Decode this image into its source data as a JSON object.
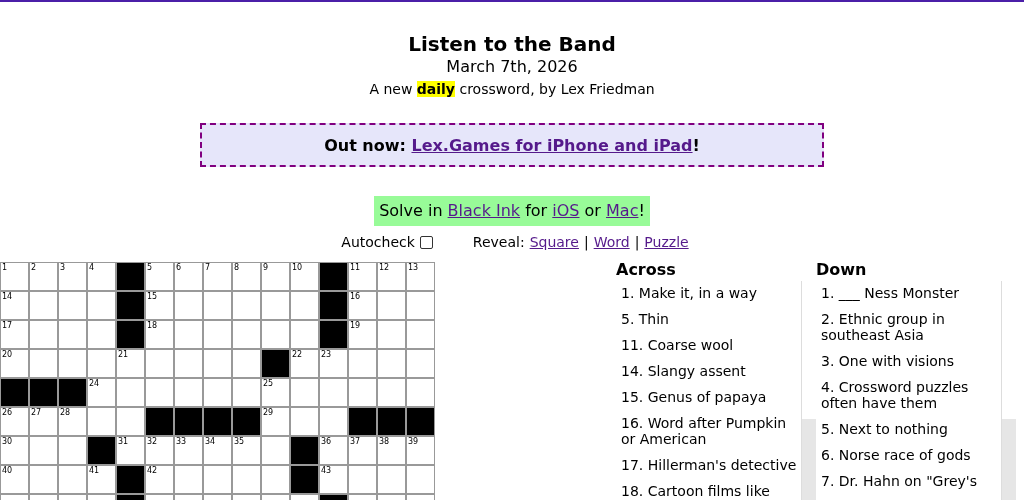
{
  "header": {
    "title": "Listen to the Band",
    "date": "March 7th, 2026",
    "subtitle": "A new **daily** crossword, by Lex Friedman"
  },
  "banner": {
    "lead": "Out now: ",
    "link": "Lex.Games for iPhone and iPad",
    "trail": "!"
  },
  "solve_in": [
    {
      "kind": "text",
      "text": "Solve in "
    },
    {
      "kind": "link",
      "text": "Black Ink"
    },
    {
      "kind": "text",
      "text": " for "
    },
    {
      "kind": "link",
      "text": "iOS"
    },
    {
      "kind": "text",
      "text": " or "
    },
    {
      "kind": "link",
      "text": "Mac"
    },
    {
      "kind": "text",
      "text": "!"
    }
  ],
  "autocheck": {
    "label": "Autocheck",
    "checked": false
  },
  "reveal": {
    "label": "Reveal:",
    "separator": "|",
    "links": [
      "Square",
      "Word",
      "Puzzle"
    ]
  },
  "grid": [
    [
      {
        "kind": "open",
        "number": "1"
      },
      {
        "kind": "open",
        "number": "2"
      },
      {
        "kind": "open",
        "number": "3"
      },
      {
        "kind": "open",
        "number": "4"
      },
      {
        "kind": "black"
      },
      {
        "kind": "open",
        "number": "5"
      },
      {
        "kind": "open",
        "number": "6"
      },
      {
        "kind": "open",
        "number": "7"
      },
      {
        "kind": "open",
        "number": "8"
      },
      {
        "kind": "open",
        "number": "9"
      },
      {
        "kind": "open",
        "number": "10"
      },
      {
        "kind": "black"
      },
      {
        "kind": "open",
        "number": "11"
      },
      {
        "kind": "open",
        "number": "12"
      },
      {
        "kind": "open",
        "number": "13"
      }
    ],
    [
      {
        "kind": "open",
        "number": "14"
      },
      {
        "kind": "open"
      },
      {
        "kind": "open"
      },
      {
        "kind": "open"
      },
      {
        "kind": "black"
      },
      {
        "kind": "open",
        "number": "15"
      },
      {
        "kind": "open"
      },
      {
        "kind": "open"
      },
      {
        "kind": "open"
      },
      {
        "kind": "open"
      },
      {
        "kind": "open"
      },
      {
        "kind": "black"
      },
      {
        "kind": "open",
        "number": "16"
      },
      {
        "kind": "open"
      },
      {
        "kind": "open"
      }
    ],
    [
      {
        "kind": "open",
        "number": "17"
      },
      {
        "kind": "open"
      },
      {
        "kind": "open"
      },
      {
        "kind": "open"
      },
      {
        "kind": "black"
      },
      {
        "kind": "open",
        "number": "18"
      },
      {
        "kind": "open"
      },
      {
        "kind": "open"
      },
      {
        "kind": "open"
      },
      {
        "kind": "open"
      },
      {
        "kind": "open"
      },
      {
        "kind": "black"
      },
      {
        "kind": "open",
        "number": "19"
      },
      {
        "kind": "open"
      },
      {
        "kind": "open"
      }
    ],
    [
      {
        "kind": "open",
        "number": "20"
      },
      {
        "kind": "open"
      },
      {
        "kind": "open"
      },
      {
        "kind": "open"
      },
      {
        "kind": "open",
        "number": "21"
      },
      {
        "kind": "open"
      },
      {
        "kind": "open"
      },
      {
        "kind": "open"
      },
      {
        "kind": "open"
      },
      {
        "kind": "black"
      },
      {
        "kind": "open",
        "number": "22"
      },
      {
        "kind": "open",
        "number": "23"
      },
      {
        "kind": "open"
      },
      {
        "kind": "open"
      },
      {
        "kind": "open"
      }
    ],
    [
      {
        "kind": "black"
      },
      {
        "kind": "black"
      },
      {
        "kind": "black"
      },
      {
        "kind": "open",
        "number": "24"
      },
      {
        "kind": "open"
      },
      {
        "kind": "open"
      },
      {
        "kind": "open"
      },
      {
        "kind": "open"
      },
      {
        "kind": "open"
      },
      {
        "kind": "open",
        "number": "25"
      },
      {
        "kind": "open"
      },
      {
        "kind": "open"
      },
      {
        "kind": "open"
      },
      {
        "kind": "open"
      },
      {
        "kind": "open"
      }
    ],
    [
      {
        "kind": "open",
        "number": "26"
      },
      {
        "kind": "open",
        "number": "27"
      },
      {
        "kind": "open",
        "number": "28"
      },
      {
        "kind": "open"
      },
      {
        "kind": "open"
      },
      {
        "kind": "black"
      },
      {
        "kind": "black"
      },
      {
        "kind": "black"
      },
      {
        "kind": "black"
      },
      {
        "kind": "open",
        "number": "29"
      },
      {
        "kind": "open"
      },
      {
        "kind": "open"
      },
      {
        "kind": "black"
      },
      {
        "kind": "black"
      },
      {
        "kind": "black"
      }
    ],
    [
      {
        "kind": "open",
        "number": "30"
      },
      {
        "kind": "open"
      },
      {
        "kind": "open"
      },
      {
        "kind": "black"
      },
      {
        "kind": "open",
        "number": "31"
      },
      {
        "kind": "open",
        "number": "32"
      },
      {
        "kind": "open",
        "number": "33"
      },
      {
        "kind": "open",
        "number": "34"
      },
      {
        "kind": "open",
        "number": "35"
      },
      {
        "kind": "open"
      },
      {
        "kind": "black"
      },
      {
        "kind": "open",
        "number": "36"
      },
      {
        "kind": "open",
        "number": "37"
      },
      {
        "kind": "open",
        "number": "38"
      },
      {
        "kind": "open",
        "number": "39"
      }
    ],
    [
      {
        "kind": "open",
        "number": "40"
      },
      {
        "kind": "open"
      },
      {
        "kind": "open"
      },
      {
        "kind": "open",
        "number": "41"
      },
      {
        "kind": "black"
      },
      {
        "kind": "open",
        "number": "42"
      },
      {
        "kind": "open"
      },
      {
        "kind": "open"
      },
      {
        "kind": "open"
      },
      {
        "kind": "open"
      },
      {
        "kind": "black"
      },
      {
        "kind": "open",
        "number": "43"
      },
      {
        "kind": "open"
      },
      {
        "kind": "open"
      },
      {
        "kind": "open"
      }
    ],
    [
      {
        "kind": "open"
      },
      {
        "kind": "open"
      },
      {
        "kind": "open"
      },
      {
        "kind": "open"
      },
      {
        "kind": "black"
      },
      {
        "kind": "open"
      },
      {
        "kind": "open"
      },
      {
        "kind": "open"
      },
      {
        "kind": "open"
      },
      {
        "kind": "open"
      },
      {
        "kind": "open"
      },
      {
        "kind": "black"
      },
      {
        "kind": "open"
      },
      {
        "kind": "open"
      },
      {
        "kind": "open"
      }
    ]
  ],
  "clues": [
    {
      "heading": "Across",
      "items": [
        "1. Make it, in a way",
        "5. Thin",
        "11. Coarse wool",
        "14. Slangy assent",
        "15. Genus of papaya",
        "16. Word after Pumpkin or American",
        "17. Hillerman's detective",
        "18. Cartoon films like"
      ]
    },
    {
      "heading": "Down",
      "items": [
        "1. ___ Ness Monster",
        "2. Ethnic group in southeast Asia",
        "3. One with visions",
        "4. Crossword puzzles often have them",
        "5. Next to nothing",
        "6. Norse race of gods",
        "7. Dr. Hahn on \"Grey's"
      ]
    }
  ]
}
